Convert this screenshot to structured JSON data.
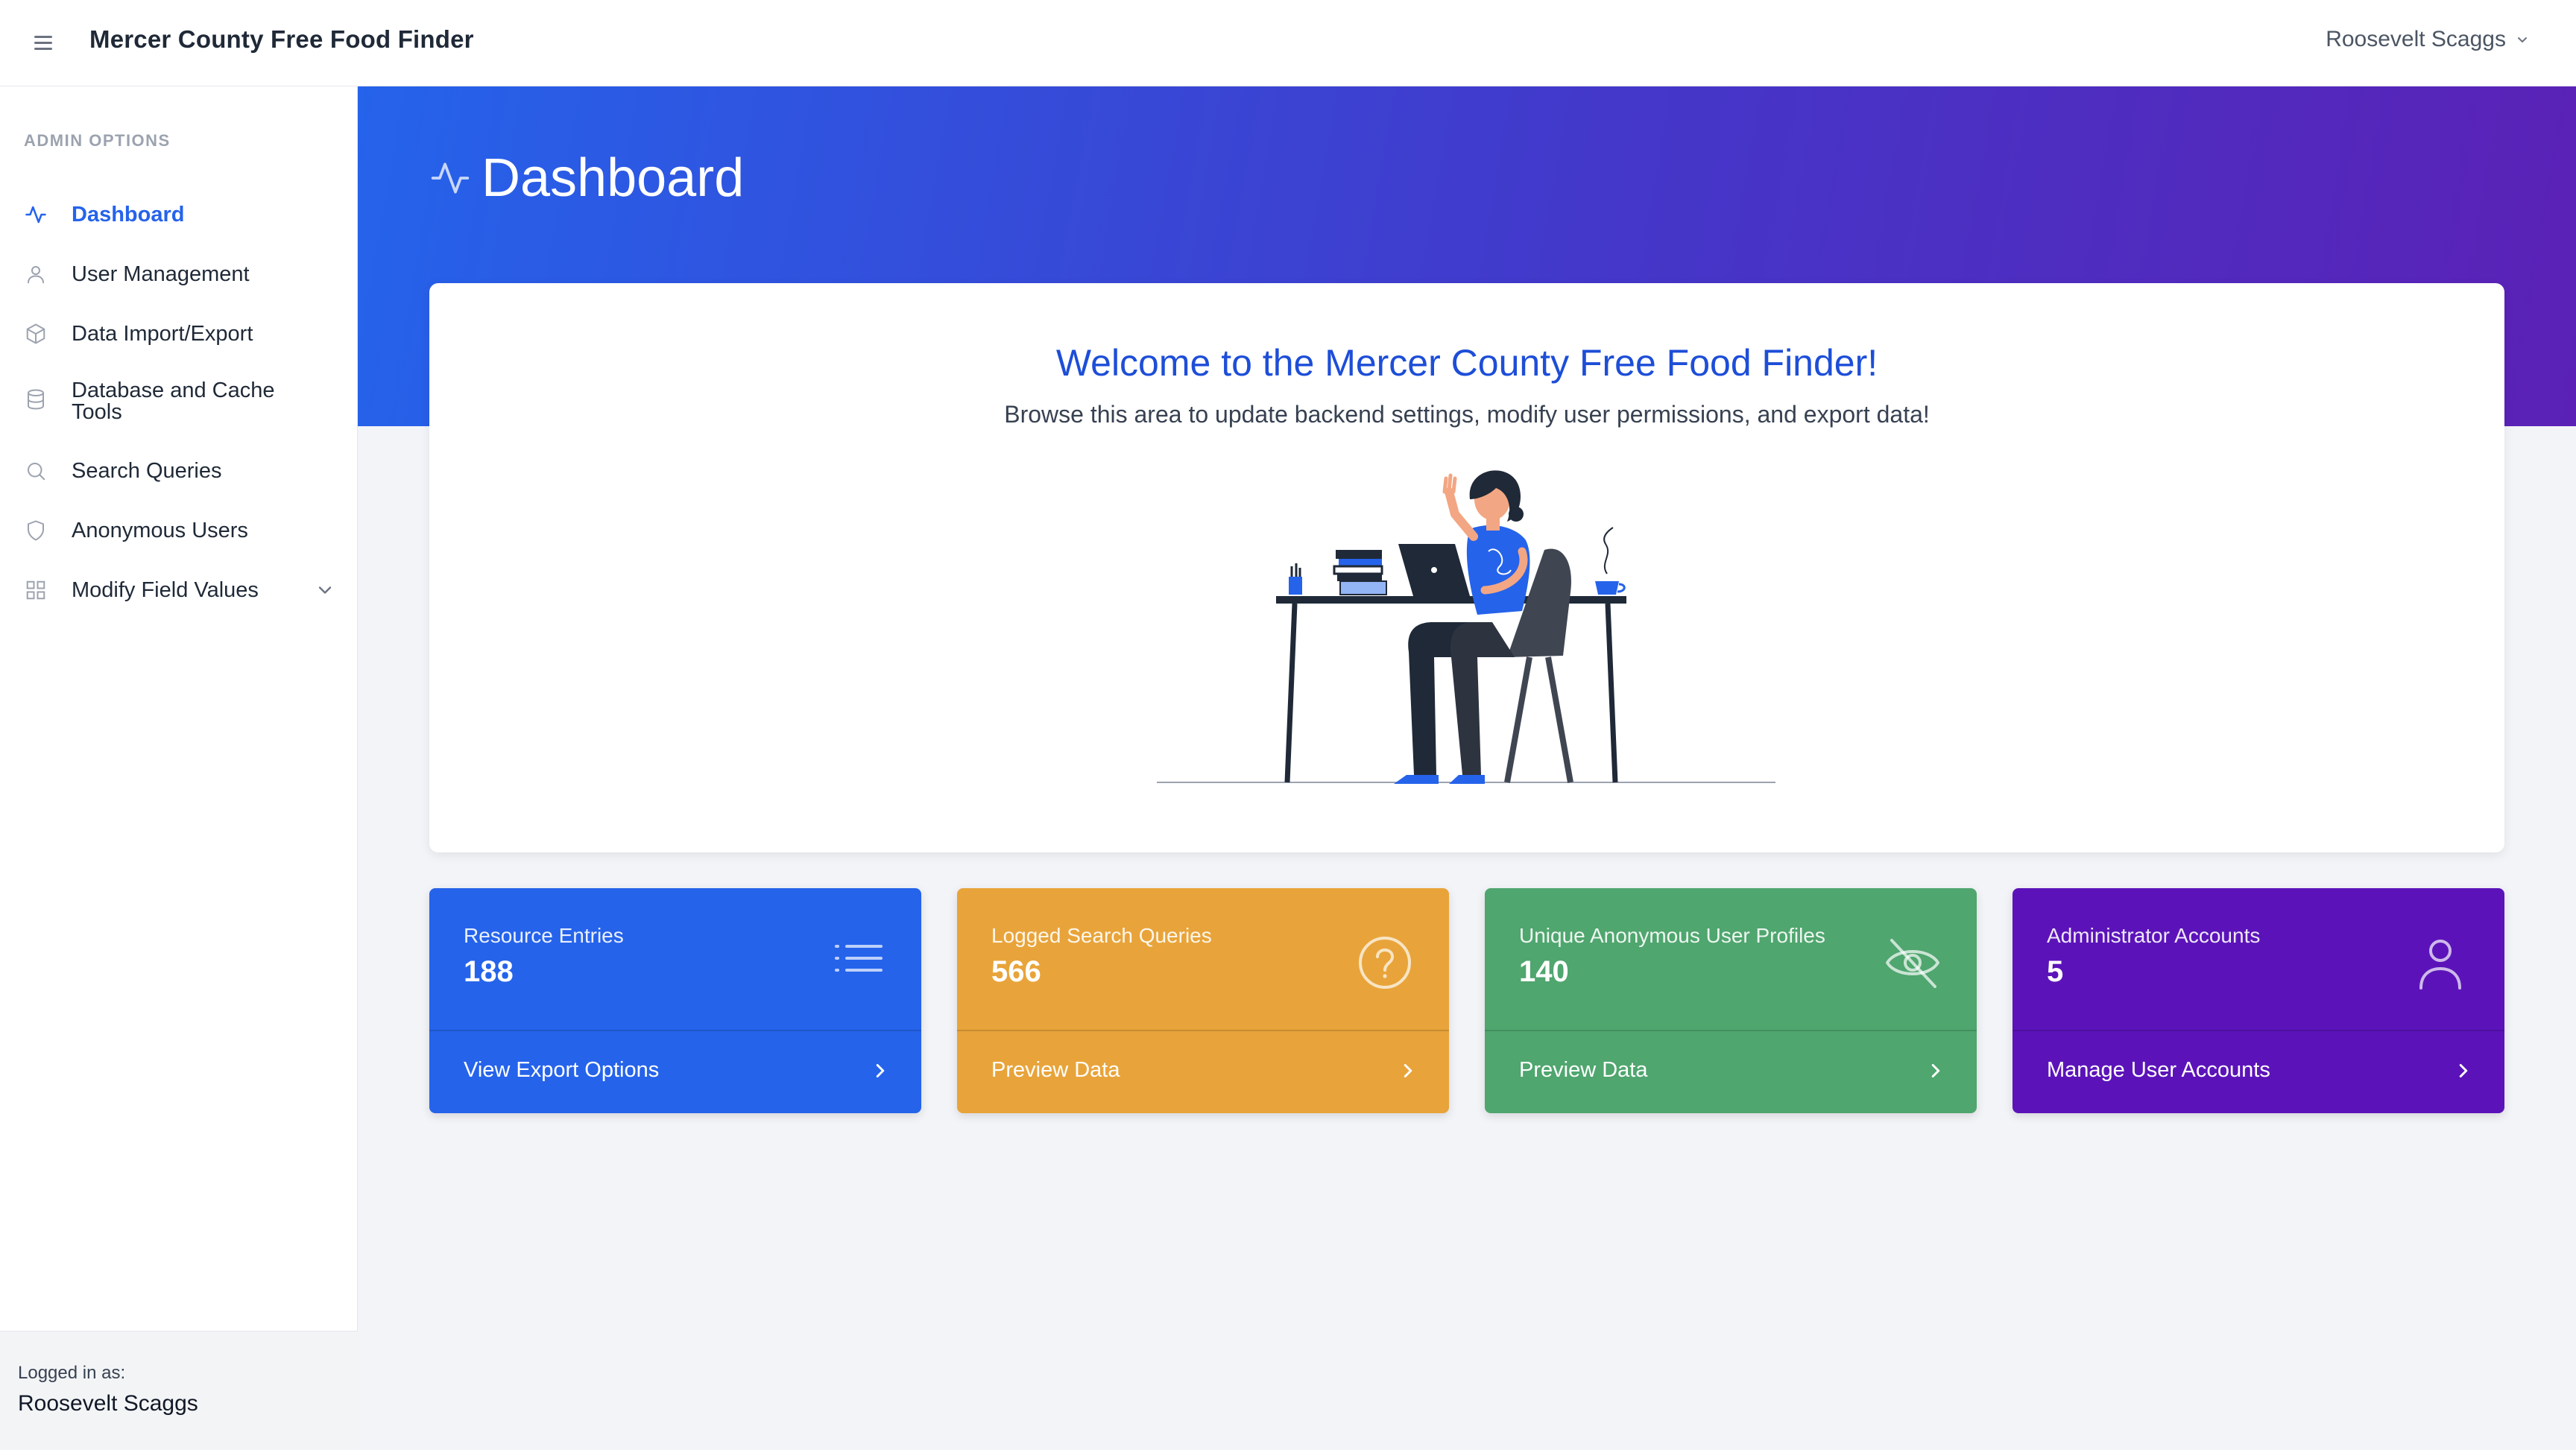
{
  "app": {
    "title": "Mercer County Free Food Finder",
    "user_menu_label": "Roosevelt Scaggs"
  },
  "sidebar": {
    "heading": "ADMIN OPTIONS",
    "items": [
      {
        "label": "Dashboard",
        "icon": "activity-icon",
        "active": true
      },
      {
        "label": "User Management",
        "icon": "user-icon",
        "active": false
      },
      {
        "label": "Data Import/Export",
        "icon": "cube-icon",
        "active": false
      },
      {
        "label": "Database and Cache Tools",
        "icon": "database-icon",
        "active": false
      },
      {
        "label": "Search Queries",
        "icon": "search-icon",
        "active": false
      },
      {
        "label": "Anonymous Users",
        "icon": "shield-icon",
        "active": false
      },
      {
        "label": "Modify Field Values",
        "icon": "grid-icon",
        "active": false,
        "expandable": true
      }
    ],
    "footer": {
      "label": "Logged in as:",
      "user": "Roosevelt Scaggs"
    }
  },
  "page": {
    "title": "Dashboard"
  },
  "welcome": {
    "title": "Welcome to the Mercer County Free Food Finder!",
    "subtitle": "Browse this area to update backend settings, modify user permissions, and export data!"
  },
  "stats": [
    {
      "label": "Resource Entries",
      "value": "188",
      "link": "View Export Options",
      "icon": "list-icon",
      "color": "#2563eb"
    },
    {
      "label": "Logged Search Queries",
      "value": "566",
      "link": "Preview Data",
      "icon": "question-circle-icon",
      "color": "#e8a43a"
    },
    {
      "label": "Unique Anonymous User Profiles",
      "value": "140",
      "link": "Preview Data",
      "icon": "eye-off-icon",
      "color": "#4fa66e"
    },
    {
      "label": "Administrator Accounts",
      "value": "5",
      "link": "Manage User Accounts",
      "icon": "user-icon",
      "color": "#5b13b9"
    }
  ],
  "colors": {
    "accent": "#2563eb",
    "hero_gradient_start": "#2563eb",
    "hero_gradient_end": "#5b21b6"
  }
}
